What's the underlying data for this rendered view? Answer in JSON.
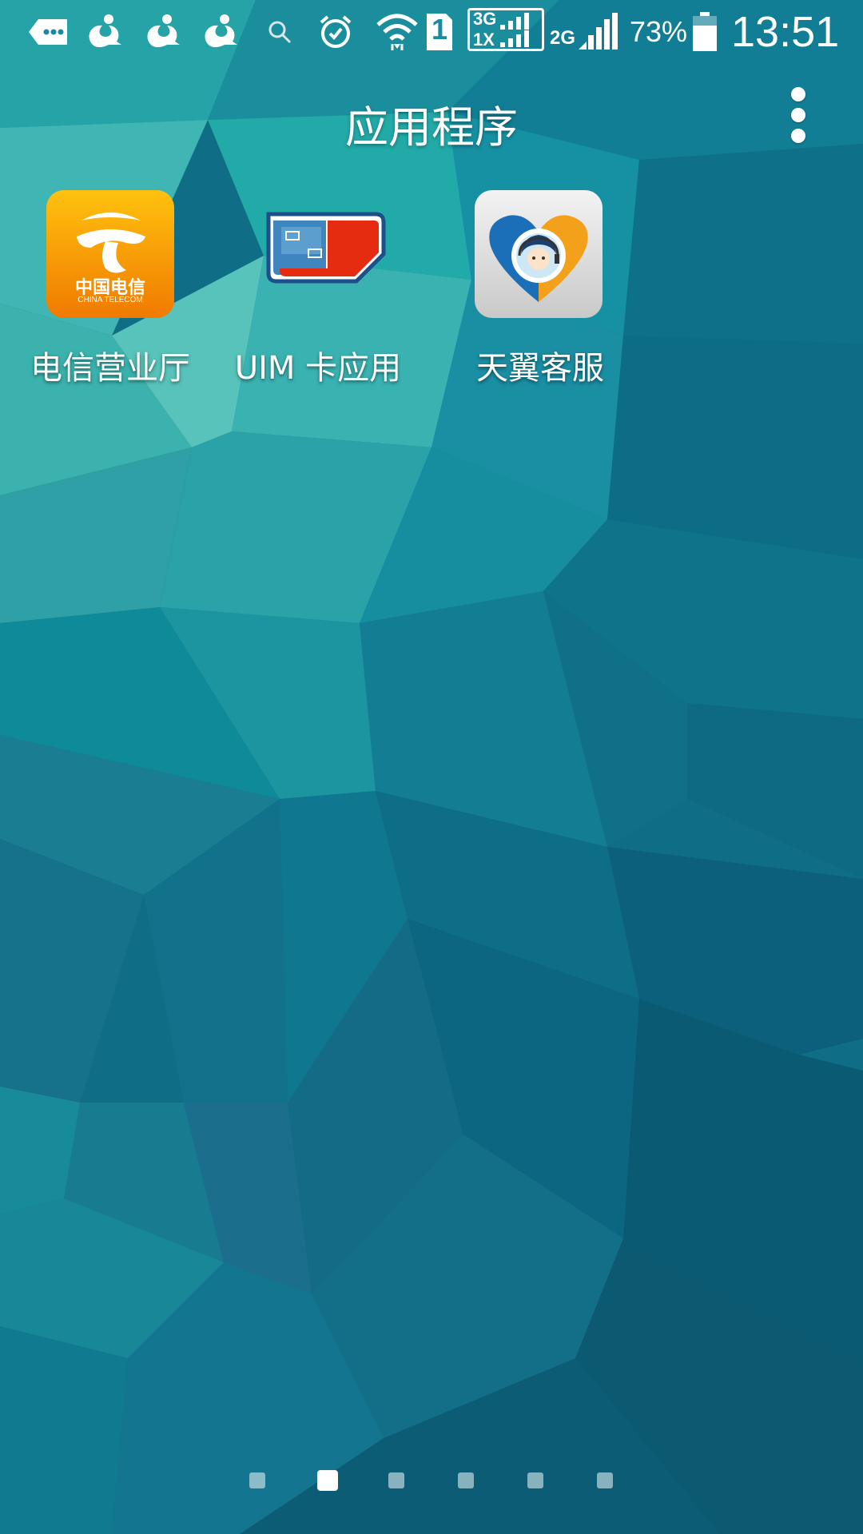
{
  "statusbar": {
    "battery_percent": "73%",
    "time": "13:51",
    "sim_slot": "1",
    "network_3g": "3G",
    "network_1x": "1X",
    "network_2g": "2G",
    "icons": [
      "chat-icon",
      "uc-browser-icon",
      "uc-browser-icon",
      "uc-browser-icon",
      "search-icon",
      "alarm-icon",
      "wifi-icon",
      "sim-icon",
      "signal-3g-icon",
      "signal-2g-icon",
      "battery-icon"
    ]
  },
  "header": {
    "title": "应用程序"
  },
  "apps": [
    {
      "label": "电信营业厅",
      "icon": "china-telecom-icon",
      "icon_logo_text": "中国电信",
      "icon_logo_sub": "CHINA TELECOM"
    },
    {
      "label": "UIM 卡应用",
      "icon": "uim-card-icon"
    },
    {
      "label": "天翼客服",
      "icon": "tianyi-service-icon"
    }
  ],
  "pager": {
    "page_count": 6,
    "active_page": 2
  },
  "colors": {
    "wallpaper_base": "#0e6f86",
    "telecom_orange": "#f59a05",
    "uim_red": "#e22b10",
    "uim_blue": "#2b6ca8"
  }
}
